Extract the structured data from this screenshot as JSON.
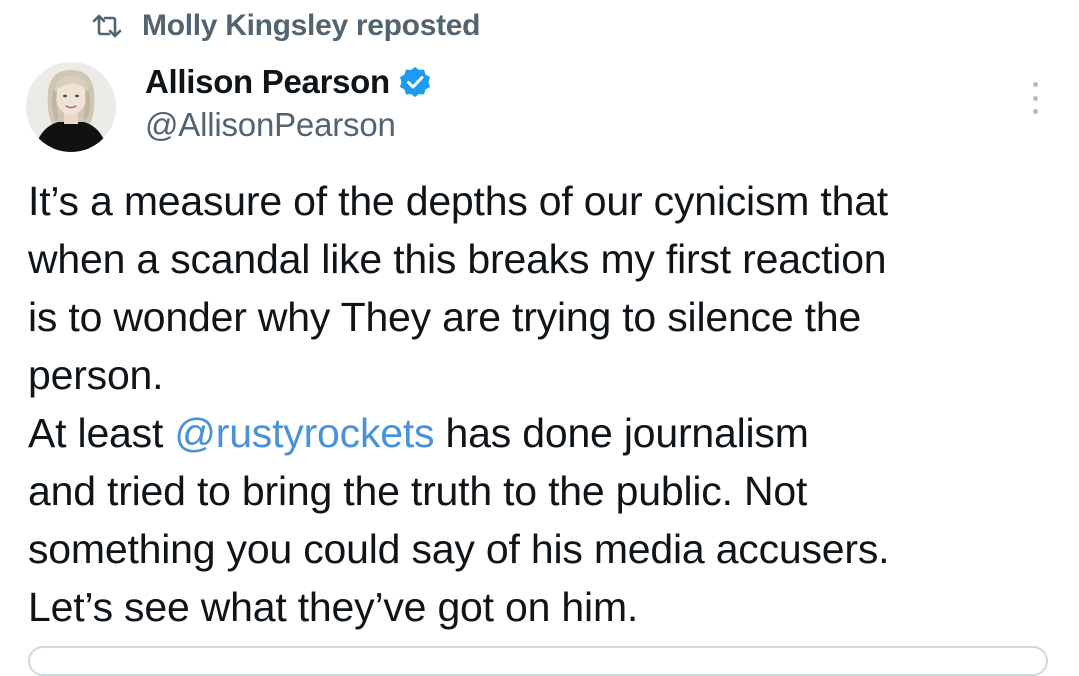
{
  "repost": {
    "text": "Molly Kingsley reposted",
    "icon": "repost-icon"
  },
  "author": {
    "name": "Allison Pearson",
    "handle": "@AllisonPearson",
    "verified": true,
    "verified_icon": "verified-badge-icon",
    "avatar_icon": "avatar-photo"
  },
  "more_icon": "more-options-icon",
  "tweet": {
    "line1": "It’s a measure of the depths of our cynicism that",
    "line2": "when a scandal like this breaks my first reaction",
    "line3": "is to wonder why They are trying to silence the",
    "line4": "person.",
    "line5_prefix": "At least ",
    "line5_mention": "@rustyrockets",
    "line5_suffix": " has done journalism",
    "line6": "and tried to bring the truth to the public. Not",
    "line7": "something you could say of his media accusers.",
    "line8": " Let’s see what they’ve got on him."
  },
  "colors": {
    "text": "#0f1419",
    "secondary": "#536471",
    "mention": "#4a92d8",
    "verified": "#1d9bf0",
    "border": "#cfd9de"
  }
}
